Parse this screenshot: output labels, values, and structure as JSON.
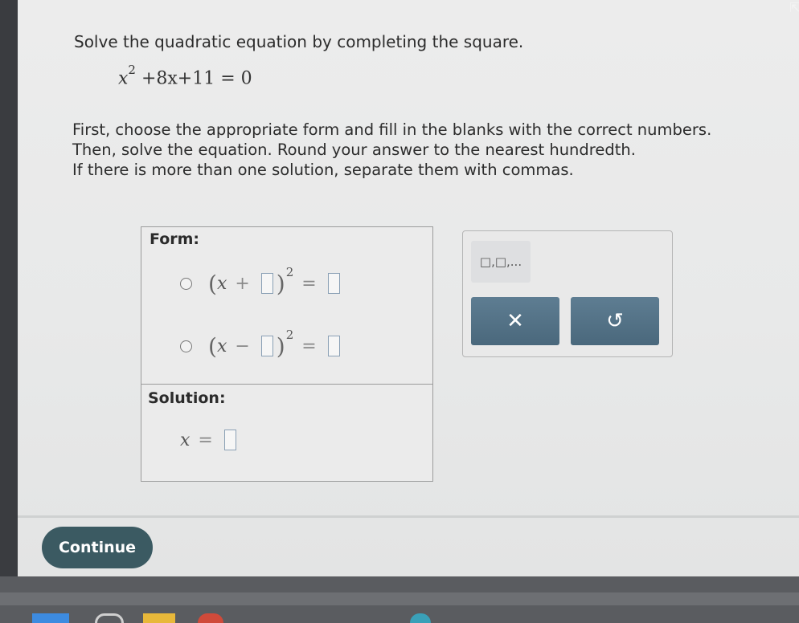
{
  "problem": {
    "prompt": "Solve the quadratic equation by completing the square.",
    "equation": {
      "x": "x",
      "exponent": "2",
      "rest": "+8x+11 = 0"
    },
    "instructions": [
      "First, choose the appropriate form and fill in the blanks with the correct numbers.",
      "Then, solve the equation. Round your answer to the nearest hundredth.",
      "If there is more than one solution, separate them with commas."
    ]
  },
  "answer": {
    "form_label": "Form:",
    "options": [
      {
        "left": "(",
        "var": "x",
        "op": "+",
        "exp": "2",
        "equals": "="
      },
      {
        "left": "(",
        "var": "x",
        "op": "−",
        "exp": "2",
        "equals": "="
      }
    ],
    "solution_label": "Solution:",
    "solution_var": "x",
    "solution_equals": "="
  },
  "tools": {
    "multi_answer_label": "□,□,...",
    "clear_symbol": "✕",
    "undo_symbol": "↺"
  },
  "footer": {
    "continue_label": "Continue"
  },
  "colors": {
    "continue_bg": "#3b5a62",
    "tool_button_bg": "#4a687c"
  }
}
